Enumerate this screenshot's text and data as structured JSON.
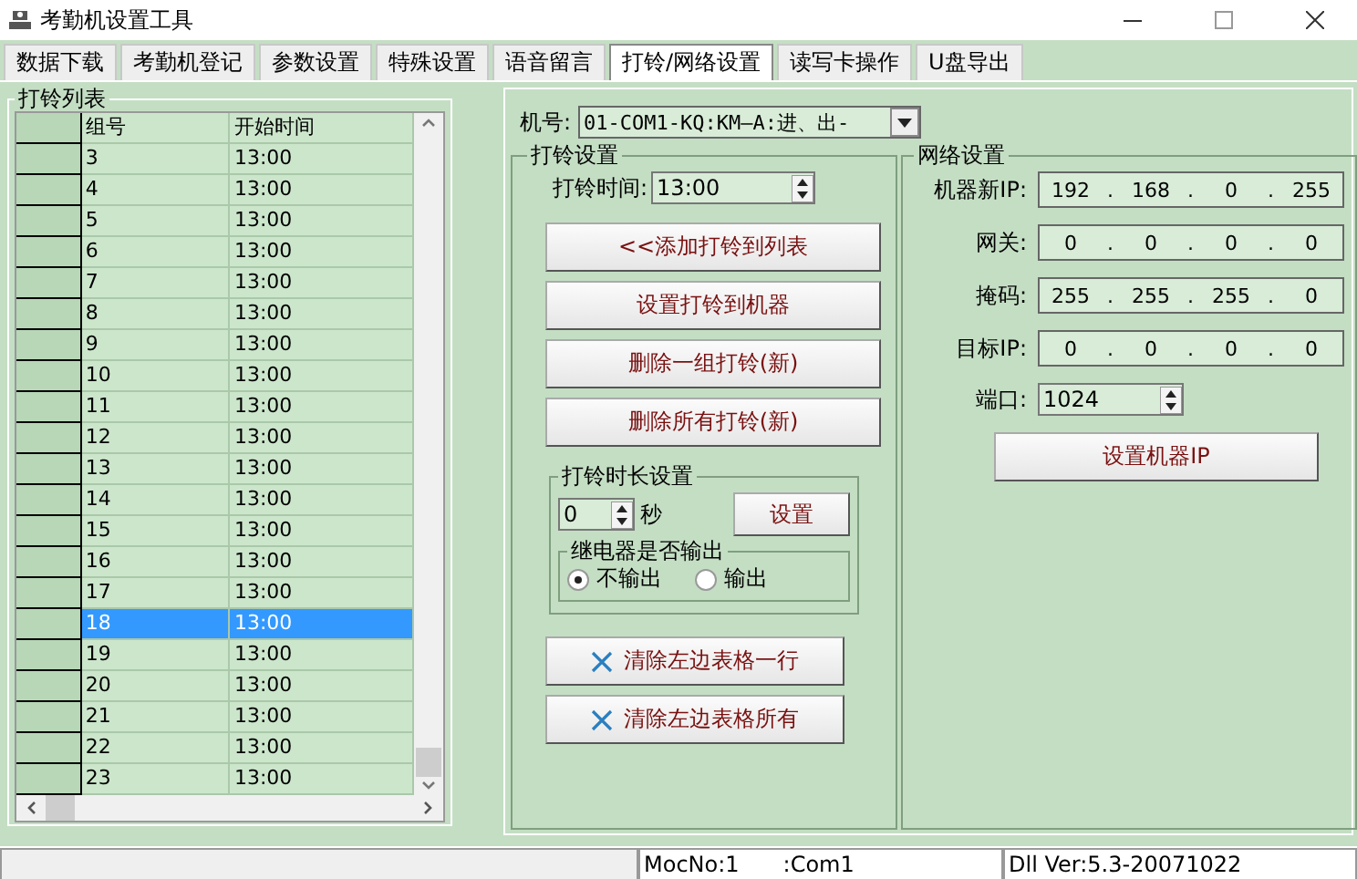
{
  "window": {
    "title": "考勤机设置工具"
  },
  "tabs": [
    {
      "label": "数据下载",
      "selected": false
    },
    {
      "label": "考勤机登记",
      "selected": false
    },
    {
      "label": "参数设置",
      "selected": false
    },
    {
      "label": "特殊设置",
      "selected": false
    },
    {
      "label": "语音留言",
      "selected": false
    },
    {
      "label": "打铃/网络设置",
      "selected": true
    },
    {
      "label": "读写卡操作",
      "selected": false
    },
    {
      "label": "U盘导出",
      "selected": false
    }
  ],
  "bell_list": {
    "title": "打铃列表",
    "columns": [
      "组号",
      "开始时间"
    ],
    "rows": [
      {
        "group": "3",
        "time": "13:00",
        "selected": false
      },
      {
        "group": "4",
        "time": "13:00",
        "selected": false
      },
      {
        "group": "5",
        "time": "13:00",
        "selected": false
      },
      {
        "group": "6",
        "time": "13:00",
        "selected": false
      },
      {
        "group": "7",
        "time": "13:00",
        "selected": false
      },
      {
        "group": "8",
        "time": "13:00",
        "selected": false
      },
      {
        "group": "9",
        "time": "13:00",
        "selected": false
      },
      {
        "group": "10",
        "time": "13:00",
        "selected": false
      },
      {
        "group": "11",
        "time": "13:00",
        "selected": false
      },
      {
        "group": "12",
        "time": "13:00",
        "selected": false
      },
      {
        "group": "13",
        "time": "13:00",
        "selected": false
      },
      {
        "group": "14",
        "time": "13:00",
        "selected": false
      },
      {
        "group": "15",
        "time": "13:00",
        "selected": false
      },
      {
        "group": "16",
        "time": "13:00",
        "selected": false
      },
      {
        "group": "17",
        "time": "13:00",
        "selected": false
      },
      {
        "group": "18",
        "time": "13:00",
        "selected": true
      },
      {
        "group": "19",
        "time": "13:00",
        "selected": false
      },
      {
        "group": "20",
        "time": "13:00",
        "selected": false
      },
      {
        "group": "21",
        "time": "13:00",
        "selected": false
      },
      {
        "group": "22",
        "time": "13:00",
        "selected": false
      },
      {
        "group": "23",
        "time": "13:00",
        "selected": false
      }
    ]
  },
  "machine": {
    "label": "机号:",
    "value": "01-COM1-KQ:KM—A:进、出-"
  },
  "bell_settings": {
    "title": "打铃设置",
    "time_label": "打铃时间:",
    "time_value": "13:00",
    "buttons": [
      "<<添加打铃到列表",
      "设置打铃到机器",
      "删除一组打铃(新)",
      "删除所有打铃(新)"
    ],
    "duration": {
      "title": "打铃时长设置",
      "value": "0",
      "unit": "秒",
      "button": "设置",
      "relay": {
        "title": "继电器是否输出",
        "options": [
          {
            "label": "不输出",
            "selected": true
          },
          {
            "label": "输出",
            "selected": false
          }
        ]
      }
    },
    "clear_buttons": [
      "清除左边表格一行",
      "清除左边表格所有"
    ]
  },
  "network": {
    "title": "网络设置",
    "separator": ".",
    "fields": [
      {
        "label": "机器新IP:",
        "octets": [
          "192",
          "168",
          "0",
          "255"
        ]
      },
      {
        "label": "网关:",
        "octets": [
          "0",
          "0",
          "0",
          "0"
        ]
      },
      {
        "label": "掩码:",
        "octets": [
          "255",
          "255",
          "255",
          "0"
        ]
      },
      {
        "label": "目标IP:",
        "octets": [
          "0",
          "0",
          "0",
          "0"
        ]
      }
    ],
    "port": {
      "label": "端口:",
      "value": "1024"
    },
    "button": "设置机器IP"
  },
  "status_bar": {
    "moc": "MocNo:1",
    "com": ":Com1",
    "version": "Dll Ver:5.3-20071022"
  }
}
